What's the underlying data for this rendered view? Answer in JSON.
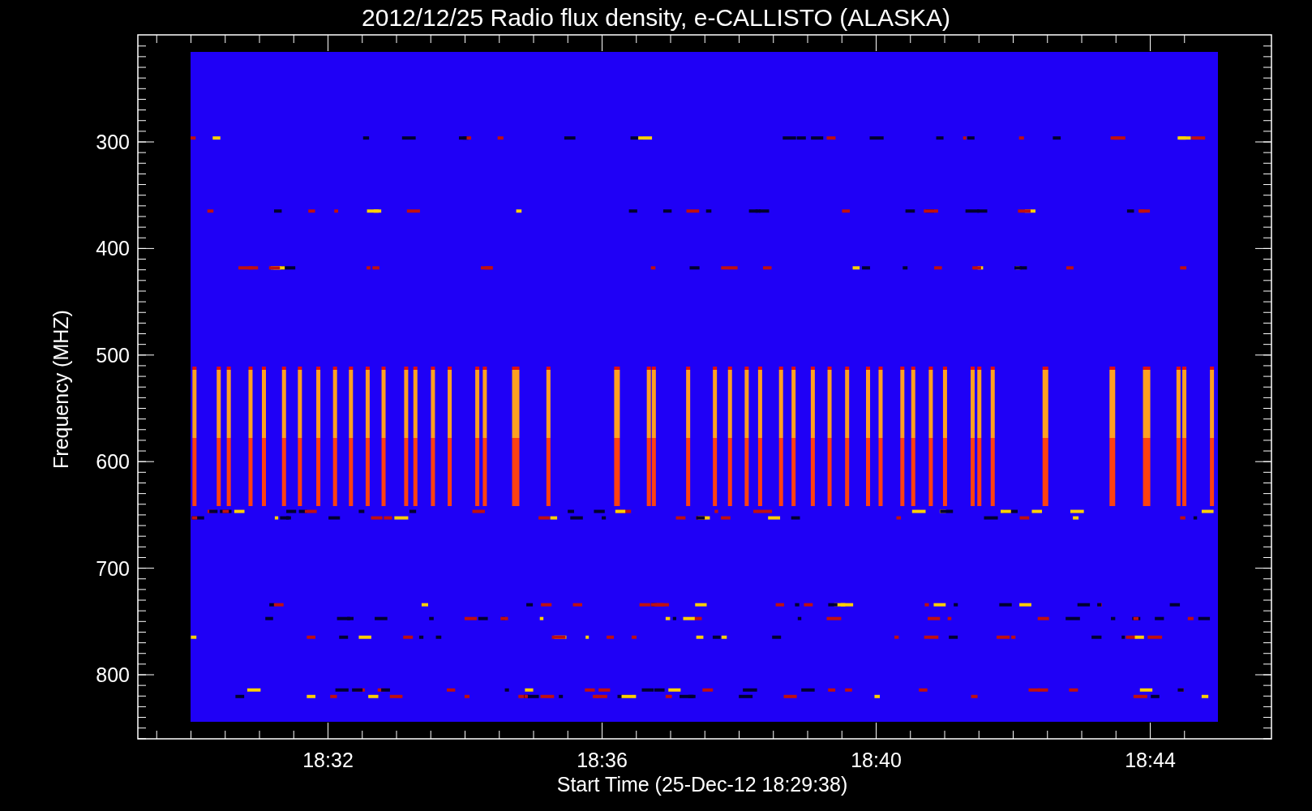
{
  "title": "2012/12/25  Radio flux density, e-CALLISTO (ALASKA)",
  "y_axis": {
    "label": "Frequency (MHZ)",
    "ticks": [
      "300",
      "400",
      "500",
      "600",
      "700",
      "800"
    ]
  },
  "x_axis": {
    "label": "Start Time (25-Dec-12 18:29:38)",
    "ticks": [
      "18:32",
      "18:36",
      "18:40",
      "18:44"
    ]
  }
}
